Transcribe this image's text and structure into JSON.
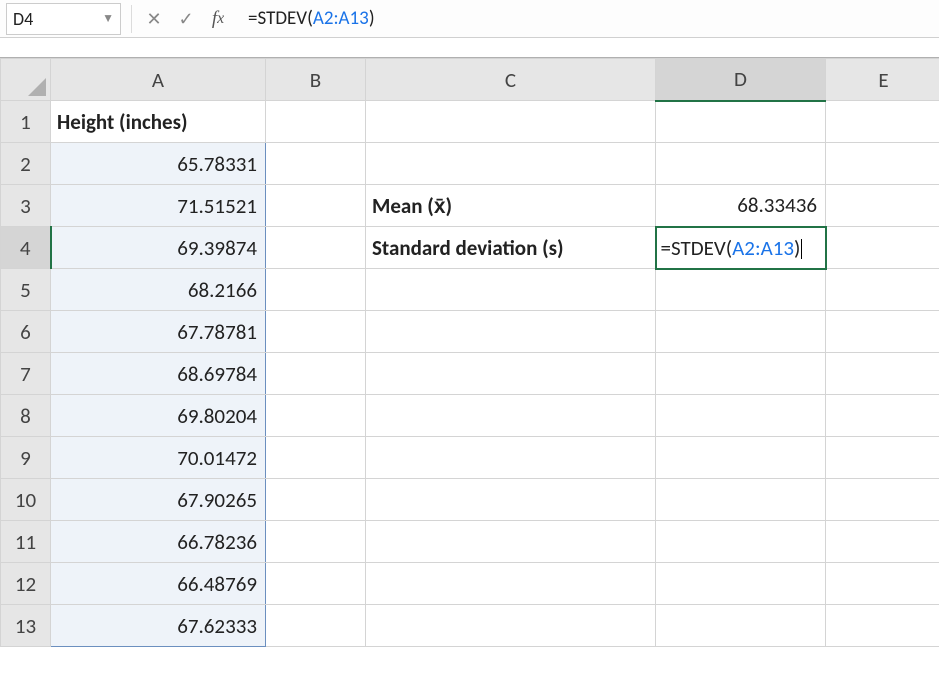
{
  "formula_bar": {
    "name_box": "D4",
    "formula_prefix": "=STDEV(",
    "formula_ref": "A2:A13",
    "formula_suffix": ")"
  },
  "columns": [
    "A",
    "B",
    "C",
    "D",
    "E"
  ],
  "rows": [
    "1",
    "2",
    "3",
    "4",
    "5",
    "6",
    "7",
    "8",
    "9",
    "10",
    "11",
    "12",
    "13"
  ],
  "active": {
    "cell": "D4",
    "col": "D",
    "row": "4"
  },
  "range_selection": "A2:A13",
  "cells": {
    "A1": "Height (inches)",
    "A2": "65.78331",
    "A3": "71.51521",
    "A4": "69.39874",
    "A5": "68.2166",
    "A6": "67.78781",
    "A7": "68.69784",
    "A8": "69.80204",
    "A9": "70.01472",
    "A10": "67.90265",
    "A11": "66.78236",
    "A12": "66.48769",
    "A13": "67.62333",
    "C3": "Mean (x̄)",
    "C4": "Standard deviation (s)",
    "D3": "68.33436",
    "D4_prefix": "=STDEV(",
    "D4_ref": "A2:A13",
    "D4_suffix": ")"
  },
  "chart_data": {
    "type": "table",
    "title": "Height (inches)",
    "header": "Height (inches)",
    "values": [
      65.78331,
      71.51521,
      69.39874,
      68.2166,
      67.78781,
      68.69784,
      69.80204,
      70.01472,
      67.90265,
      66.78236,
      66.48769,
      67.62333
    ],
    "stats": {
      "mean_label": "Mean (x̄)",
      "mean": 68.33436,
      "stdev_label": "Standard deviation (s)",
      "stdev_formula": "=STDEV(A2:A13)"
    }
  }
}
